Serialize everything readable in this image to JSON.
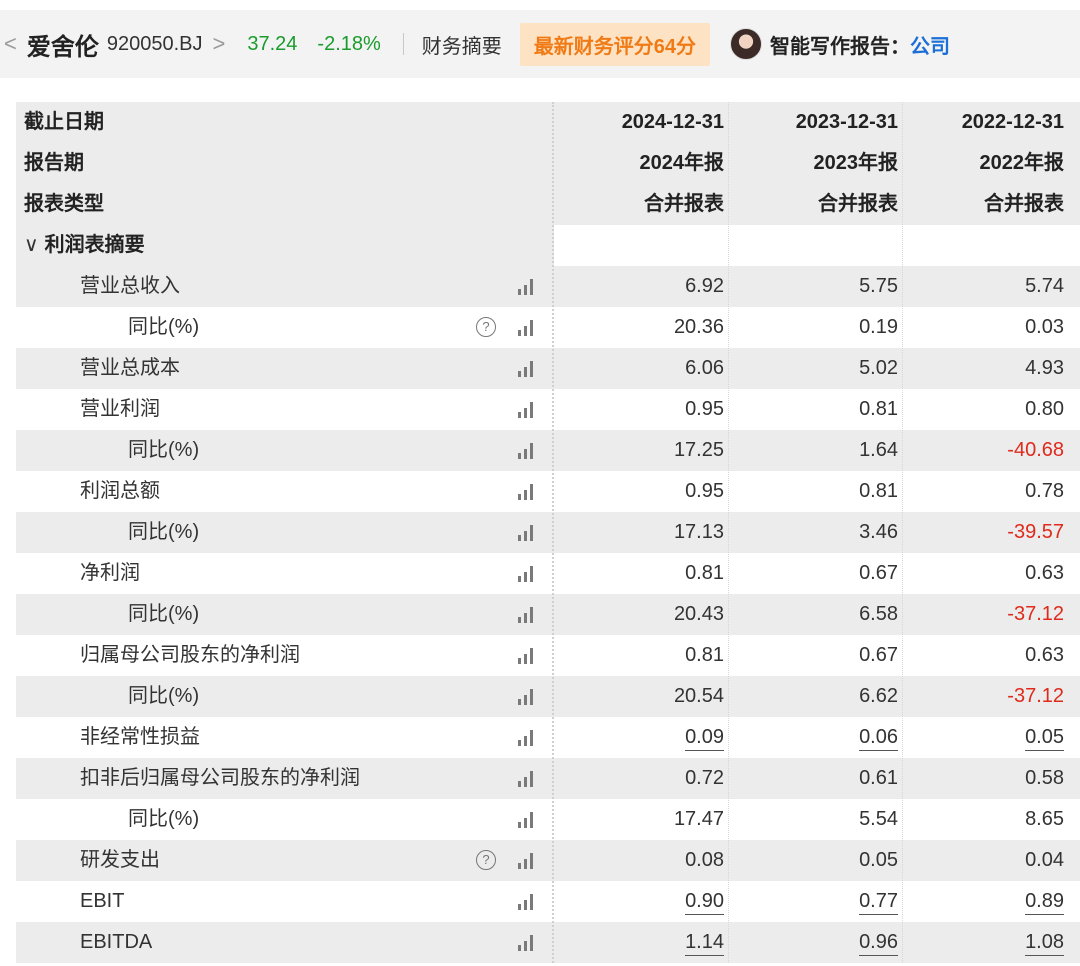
{
  "header": {
    "back_glyph": "<",
    "stock_name": "爱舍伦",
    "stock_code": "920050.BJ",
    "forward_glyph": ">",
    "price": "37.24",
    "change": "-2.18%",
    "section": "财务摘要",
    "badge": "最新财务评分64分",
    "ai_label": "智能写作报告：",
    "ai_link": "公司"
  },
  "columns": {
    "labels": [
      "截止日期",
      "报告期",
      "报表类型"
    ],
    "dates": [
      "2024-12-31",
      "2023-12-31",
      "2022-12-31"
    ],
    "periods": [
      "2024年报",
      "2023年报",
      "2022年报"
    ],
    "types": [
      "合并报表",
      "合并报表",
      "合并报表"
    ]
  },
  "section": {
    "title": "利润表摘要"
  },
  "rows": [
    {
      "label": "营业总收入",
      "values": [
        "6.92",
        "5.75",
        "5.74"
      ]
    },
    {
      "label": "同比(%)",
      "values": [
        "20.36",
        "0.19",
        "0.03"
      ]
    },
    {
      "label": "营业总成本",
      "values": [
        "6.06",
        "5.02",
        "4.93"
      ]
    },
    {
      "label": "营业利润",
      "values": [
        "0.95",
        "0.81",
        "0.80"
      ]
    },
    {
      "label": "同比(%)",
      "values": [
        "17.25",
        "1.64",
        "-40.68"
      ]
    },
    {
      "label": "利润总额",
      "values": [
        "0.95",
        "0.81",
        "0.78"
      ]
    },
    {
      "label": "同比(%)",
      "values": [
        "17.13",
        "3.46",
        "-39.57"
      ]
    },
    {
      "label": "净利润",
      "values": [
        "0.81",
        "0.67",
        "0.63"
      ]
    },
    {
      "label": "同比(%)",
      "values": [
        "20.43",
        "6.58",
        "-37.12"
      ]
    },
    {
      "label": "归属母公司股东的净利润",
      "values": [
        "0.81",
        "0.67",
        "0.63"
      ]
    },
    {
      "label": "同比(%)",
      "values": [
        "20.54",
        "6.62",
        "-37.12"
      ]
    },
    {
      "label": "非经常性损益",
      "values": [
        "0.09",
        "0.06",
        "0.05"
      ]
    },
    {
      "label": "扣非后归属母公司股东的净利润",
      "values": [
        "0.72",
        "0.61",
        "0.58"
      ]
    },
    {
      "label": "同比(%)",
      "values": [
        "17.47",
        "5.54",
        "8.65"
      ]
    },
    {
      "label": "研发支出",
      "values": [
        "0.08",
        "0.05",
        "0.04"
      ]
    },
    {
      "label": "EBIT",
      "values": [
        "0.90",
        "0.77",
        "0.89"
      ]
    },
    {
      "label": "EBITDA",
      "values": [
        "1.14",
        "0.96",
        "1.08"
      ]
    }
  ],
  "icons": {
    "help": "?",
    "chart": "bar-chart-icon"
  },
  "colors": {
    "up_green": "#1a9c2c",
    "negative_red": "#e02a1c",
    "badge_bg": "#fde3c3",
    "badge_text": "#f07b16",
    "link_blue": "#1b6fd6"
  }
}
